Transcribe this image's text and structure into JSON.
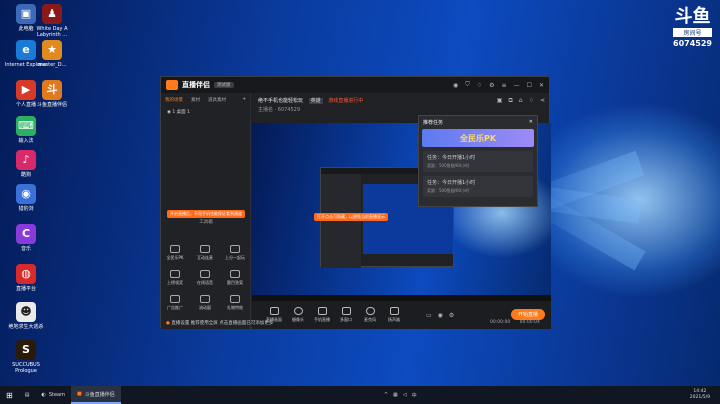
{
  "desktop": {
    "icons": [
      {
        "label": "此电脑",
        "color": "#3a6ab8",
        "glyph": "▣",
        "icon": "computer-icon"
      },
      {
        "label": "White Day A Labyrinth ...",
        "color": "#8a1a1a",
        "glyph": "♟",
        "icon": "game-icon"
      },
      {
        "label": "Internet Explorer",
        "color": "#1a7ad8",
        "glyph": "e",
        "icon": "ie-icon"
      },
      {
        "label": "master_D...",
        "color": "#e08a20",
        "glyph": "★",
        "icon": "app-icon"
      },
      {
        "label": "个人直播",
        "color": "#d83a2a",
        "glyph": "▶",
        "icon": "live-icon"
      },
      {
        "label": "斗鱼直播伴侣",
        "color": "#e07a20",
        "glyph": "斗",
        "icon": "douyu-icon"
      },
      {
        "label": "输入法",
        "color": "#2ab060",
        "glyph": "⌨",
        "icon": "ime-icon"
      },
      {
        "label": "酷狗",
        "color": "#d82a6a",
        "glyph": "♪",
        "icon": "music-icon"
      },
      {
        "label": "猎豹浏",
        "color": "#3a70d8",
        "glyph": "◉",
        "icon": "browser-icon"
      },
      {
        "label": "音乐",
        "color": "#8a3ad8",
        "glyph": "C",
        "icon": "c-icon"
      },
      {
        "label": "直播平台",
        "color": "#d82a2a",
        "glyph": "◍",
        "icon": "stream-icon"
      },
      {
        "label": "绝地求生大逃杀",
        "color": "#eaeaea",
        "glyph": "☻",
        "icon": "panda-icon"
      },
      {
        "label": "SUCCUBUS Prologue",
        "color": "#2a1a0a",
        "glyph": "S",
        "icon": "succubus-icon"
      }
    ]
  },
  "brand": {
    "logo": "斗鱼",
    "room_label": "房间号",
    "room_id": "6074529"
  },
  "app": {
    "title": "直播伴侣",
    "version": "测试版",
    "left_tabs": [
      "我的场景",
      "素材",
      "道具素材"
    ],
    "source_item": "1 桌面 1",
    "tools_header": "工具箱",
    "tools": [
      "全民乐PK",
      "互动连麦",
      "上分一起玩",
      "上榜领奖",
      "在线语音",
      "题目答案",
      "广告推广",
      "流动窗",
      "礼物特效"
    ],
    "tip_left": "开启直播后，不用手机也能保证看到通道",
    "room_title": "绝不手机也能轻松玩",
    "room_tag1": "英雄",
    "room_tag2": "游戏直播进行中",
    "room_meta": "主播名 · 6074529",
    "tip_preview": "打开点击可隐藏，以避免当前直播显示",
    "bottom_buttons": [
      "直播画面",
      "摄像头",
      "手机直播",
      "多窗口",
      "麦克风",
      "扬声器"
    ],
    "start_btn": "开始直播",
    "notice": "直播设置 推荐使用全屏  点击直播画面已可添加更多",
    "timer1": "00:00:00",
    "timer2": "00:00:04"
  },
  "popup": {
    "title": "推荐任务",
    "banner": "全民乐PK",
    "tasks": [
      {
        "name": "任务：今日开播1小时",
        "desc": "奖励：500鱼翅/60小时"
      },
      {
        "name": "任务：今日开播1小时",
        "desc": "奖励：500鱼翅/60小时"
      }
    ]
  },
  "taskbar": {
    "items": [
      {
        "label": "Steam",
        "icon": "steam-icon"
      },
      {
        "label": "斗鱼直播伴侣",
        "icon": "douyu-task-icon",
        "active": true
      }
    ],
    "time": "14:42",
    "date": "2021/5/9"
  }
}
